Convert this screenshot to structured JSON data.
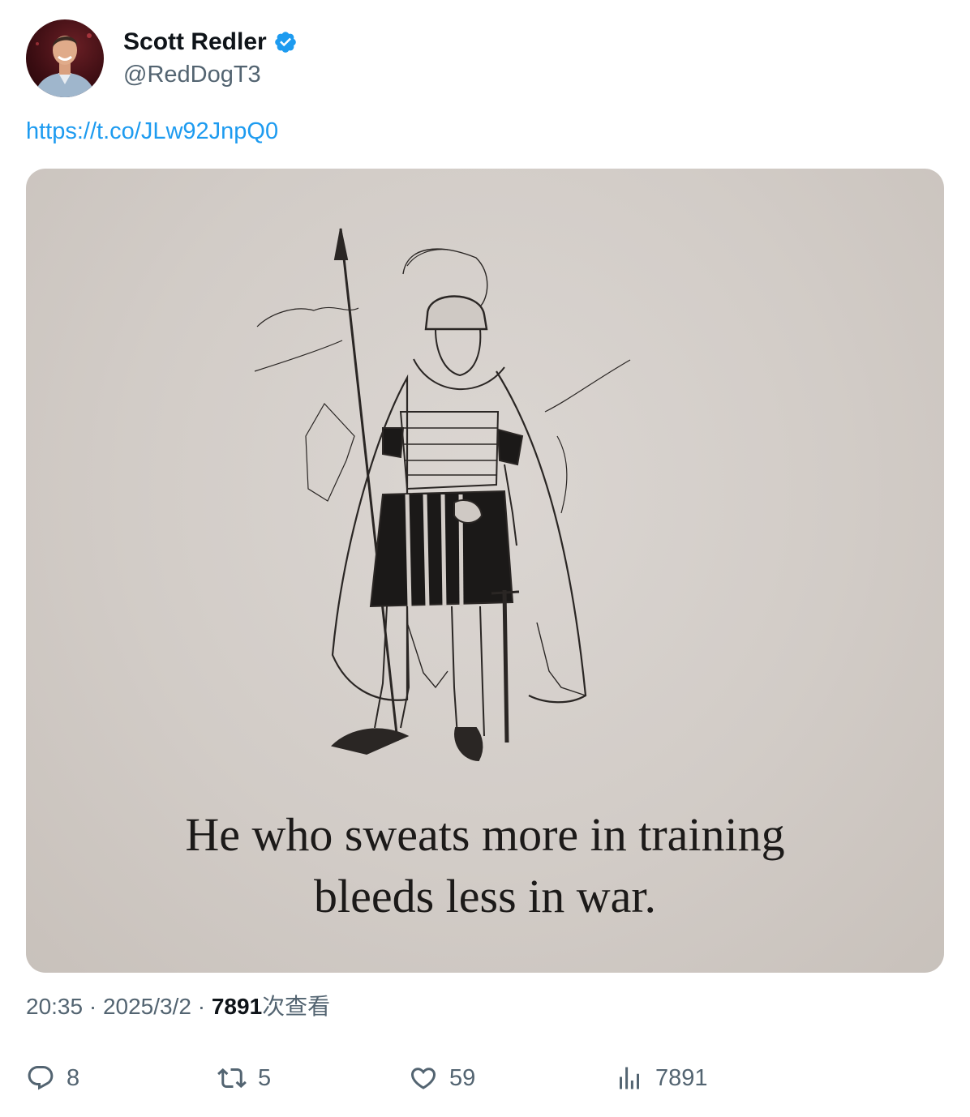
{
  "author": {
    "display_name": "Scott Redler",
    "handle": "@RedDogT3",
    "verified": true,
    "accent_color": "#1d9bf0"
  },
  "tweet": {
    "link_text": "https://t.co/JLw92JnpQ0",
    "image_caption_line1": "He who sweats more in training",
    "image_caption_line2": "bleeds less in war."
  },
  "meta": {
    "time": "20:35",
    "separator": " · ",
    "date": "2025/3/2",
    "views_count": "7891",
    "views_label": "次查看"
  },
  "actions": {
    "replies": "8",
    "retweets": "5",
    "likes": "59",
    "views": "7891"
  },
  "icons": [
    "verified-badge-icon",
    "reply-icon",
    "retweet-icon",
    "like-icon",
    "views-icon"
  ]
}
